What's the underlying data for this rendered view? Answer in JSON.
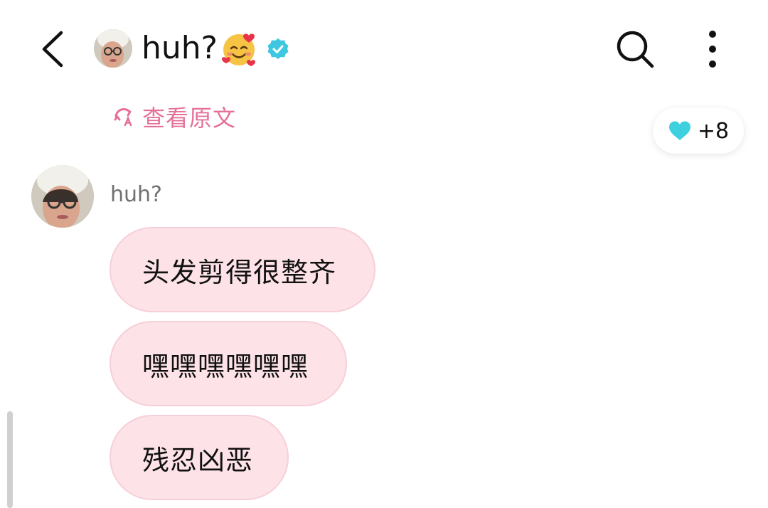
{
  "header": {
    "title": "huh?",
    "emoji_icon": "smiling-face-with-hearts",
    "verified_icon": "verified-badge",
    "colors": {
      "verified": "#3ec7e0"
    }
  },
  "translate": {
    "label": "查看原文",
    "color": "#e5709a"
  },
  "reaction": {
    "icon": "heart",
    "count": "+8",
    "color": "#3fd0e0"
  },
  "message": {
    "sender": "huh?",
    "bubbles": [
      "头发剪得很整齐",
      "嘿嘿嘿嘿嘿嘿",
      "残忍凶恶"
    ],
    "bubble_color": "#fde3e8"
  }
}
